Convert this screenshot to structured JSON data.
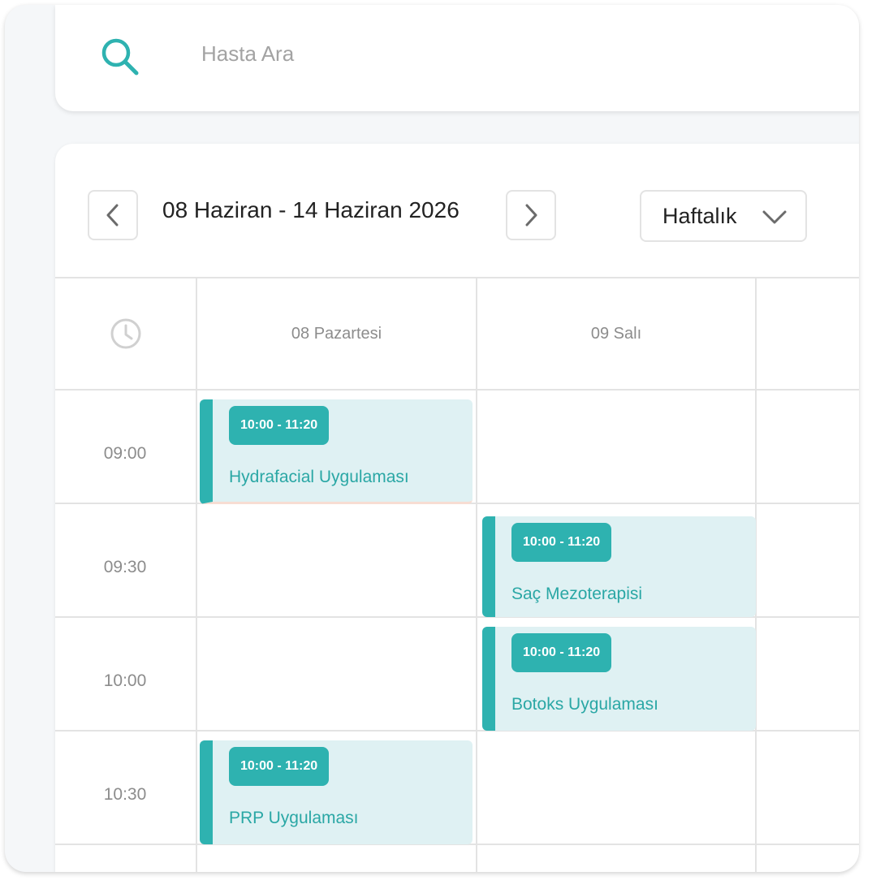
{
  "search": {
    "placeholder": "Hasta Ara"
  },
  "calendar": {
    "range_title": "08 Haziran - 14 Haziran 2026",
    "view_mode": "Haftalık",
    "days": [
      {
        "label": "08 Pazartesi"
      },
      {
        "label": "09 Salı"
      }
    ],
    "times": [
      "09:00",
      "09:30",
      "10:00",
      "10:30"
    ],
    "events": [
      {
        "time": "10:00 - 11:20",
        "title": "Hydrafacial Uygulaması",
        "day": "08 Pazartesi"
      },
      {
        "time": "10:00 - 11:20",
        "title": "Saç Mezoterapisi",
        "day": "09 Salı"
      },
      {
        "time": "10:00 - 11:20",
        "title": "Botoks Uygulaması",
        "day": "09 Salı"
      },
      {
        "time": "10:00 - 11:20",
        "title": "PRP Uygulaması",
        "day": "08 Pazartesi"
      }
    ]
  },
  "colors": {
    "accent": "#2eb2b0",
    "event_bg": "#dff1f3",
    "grid": "#e3e3e3",
    "muted_text": "#8c8c8c"
  },
  "icons": [
    "search-icon",
    "chevron-left-icon",
    "chevron-right-icon",
    "chevron-down-icon",
    "clock-icon"
  ]
}
